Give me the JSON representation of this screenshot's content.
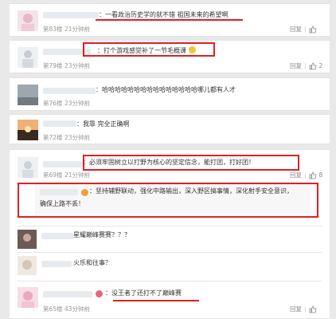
{
  "comments": [
    {
      "floor": "第83楼",
      "time": "21分钟前",
      "text": "一看政治历史学的就不错 祖国未来的希望啊",
      "prefix": "：",
      "actions": {
        "reply": "回复"
      }
    },
    {
      "floor": "第79楼",
      "time": "23分钟前",
      "text": "打个游戏感觉补了一节毛概课",
      "prefix": "：",
      "actions": {
        "reply": "回复",
        "likes": "2"
      }
    },
    {
      "floor": "第76楼",
      "time": "23分钟前",
      "text": "哈哈哈哈哈哈哈哈哈哈哈哈哈哈哈哪儿都有人才",
      "prefix": "：",
      "actions": {}
    },
    {
      "floor": "第72楼",
      "time": "23分钟前",
      "text": "我靠 完全正确啊",
      "prefix": "：",
      "actions": {}
    },
    {
      "floor": "第69楼",
      "time": "21分钟前",
      "text": "必须牢固树立以打野为核心的坚定信念，能打团，打好团！",
      "prefix": "：",
      "actions": {
        "reply": "回复",
        "likes": "8"
      },
      "reply": {
        "line1": "坚持辅野联动，强化中路输出，深入野区搞事情，深化射手安全意识，",
        "line2": "确保上路不丢！",
        "prefix": "："
      }
    },
    {
      "floor": "",
      "time": "",
      "text": "星耀巅峰赛赛？？？",
      "prefix": "",
      "actions": {}
    },
    {
      "floor": "",
      "time": "",
      "text": "火乐和往事？",
      "prefix": "",
      "actions": {}
    },
    {
      "floor": "第65楼",
      "time": "43分钟前",
      "text": "没王者了还打不了巅峰赛",
      "prefix": "：",
      "actions": {
        "reply": "回复"
      }
    }
  ],
  "colors": {
    "highlight": "#e02020",
    "panel": "#ffffff",
    "meta": "#999999"
  }
}
